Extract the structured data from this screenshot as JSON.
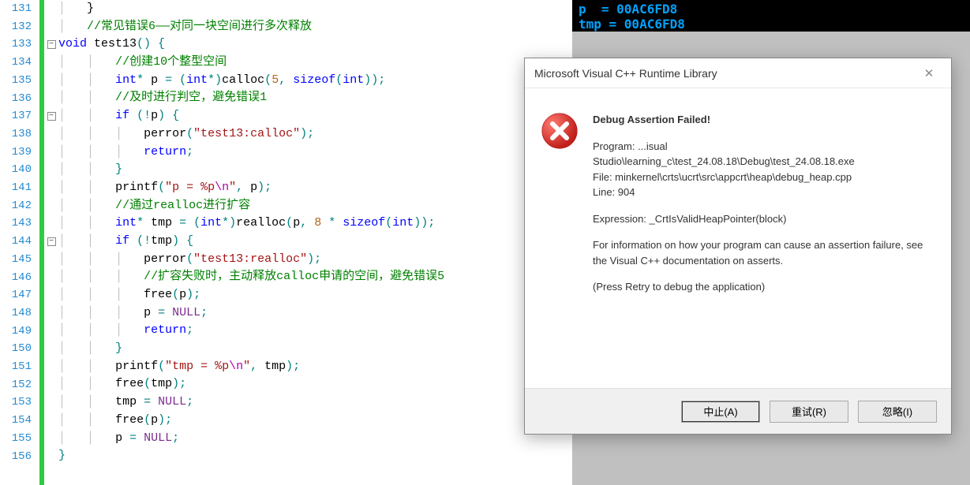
{
  "editor": {
    "first_line": 131,
    "last_line": 156,
    "fold_lines": [
      133,
      137,
      144
    ],
    "lines": [
      {
        "n": 131,
        "indent": 1,
        "segs": [
          {
            "t": "}",
            "c": "paren"
          }
        ]
      },
      {
        "n": 132,
        "indent": 1,
        "segs": [
          {
            "t": "//常见错误6——对同一块空间进行多次释放",
            "c": "comment"
          }
        ]
      },
      {
        "n": 133,
        "indent": 0,
        "fold": true,
        "segs": [
          {
            "t": "void",
            "c": "keyword"
          },
          {
            "t": " test13",
            "c": "ident"
          },
          {
            "t": "() {",
            "c": "op"
          }
        ]
      },
      {
        "n": 134,
        "indent": 2,
        "segs": [
          {
            "t": "//创建10个整型空间",
            "c": "comment"
          }
        ]
      },
      {
        "n": 135,
        "indent": 2,
        "segs": [
          {
            "t": "int",
            "c": "type"
          },
          {
            "t": "* ",
            "c": "op"
          },
          {
            "t": "p ",
            "c": "ident"
          },
          {
            "t": "= (",
            "c": "op"
          },
          {
            "t": "int",
            "c": "type"
          },
          {
            "t": "*)",
            "c": "op"
          },
          {
            "t": "calloc",
            "c": "func"
          },
          {
            "t": "(",
            "c": "op"
          },
          {
            "t": "5",
            "c": "number"
          },
          {
            "t": ", ",
            "c": "op"
          },
          {
            "t": "sizeof",
            "c": "keyword"
          },
          {
            "t": "(",
            "c": "op"
          },
          {
            "t": "int",
            "c": "type"
          },
          {
            "t": "));",
            "c": "op"
          }
        ]
      },
      {
        "n": 136,
        "indent": 2,
        "segs": [
          {
            "t": "//及时进行判空，避免错误1",
            "c": "comment"
          }
        ]
      },
      {
        "n": 137,
        "indent": 2,
        "fold": true,
        "segs": [
          {
            "t": "if",
            "c": "keyword"
          },
          {
            "t": " (!",
            "c": "op"
          },
          {
            "t": "p",
            "c": "ident"
          },
          {
            "t": ") {",
            "c": "op"
          }
        ]
      },
      {
        "n": 138,
        "indent": 3,
        "segs": [
          {
            "t": "perror",
            "c": "func"
          },
          {
            "t": "(",
            "c": "op"
          },
          {
            "t": "\"test13:calloc\"",
            "c": "string"
          },
          {
            "t": ");",
            "c": "op"
          }
        ]
      },
      {
        "n": 139,
        "indent": 3,
        "segs": [
          {
            "t": "return",
            "c": "keyword"
          },
          {
            "t": ";",
            "c": "op"
          }
        ]
      },
      {
        "n": 140,
        "indent": 2,
        "segs": [
          {
            "t": "}",
            "c": "op"
          }
        ]
      },
      {
        "n": 141,
        "indent": 2,
        "segs": [
          {
            "t": "printf",
            "c": "func"
          },
          {
            "t": "(",
            "c": "op"
          },
          {
            "t": "\"p = %p",
            "c": "string"
          },
          {
            "t": "\\n",
            "c": "escape"
          },
          {
            "t": "\"",
            "c": "string"
          },
          {
            "t": ", ",
            "c": "op"
          },
          {
            "t": "p",
            "c": "ident"
          },
          {
            "t": ");",
            "c": "op"
          }
        ]
      },
      {
        "n": 142,
        "indent": 2,
        "segs": [
          {
            "t": "//通过realloc进行扩容",
            "c": "comment"
          }
        ]
      },
      {
        "n": 143,
        "indent": 2,
        "segs": [
          {
            "t": "int",
            "c": "type"
          },
          {
            "t": "* ",
            "c": "op"
          },
          {
            "t": "tmp ",
            "c": "ident"
          },
          {
            "t": "= (",
            "c": "op"
          },
          {
            "t": "int",
            "c": "type"
          },
          {
            "t": "*)",
            "c": "op"
          },
          {
            "t": "realloc",
            "c": "func"
          },
          {
            "t": "(",
            "c": "op"
          },
          {
            "t": "p",
            "c": "ident"
          },
          {
            "t": ", ",
            "c": "op"
          },
          {
            "t": "8",
            "c": "number"
          },
          {
            "t": " * ",
            "c": "op"
          },
          {
            "t": "sizeof",
            "c": "keyword"
          },
          {
            "t": "(",
            "c": "op"
          },
          {
            "t": "int",
            "c": "type"
          },
          {
            "t": "));",
            "c": "op"
          }
        ]
      },
      {
        "n": 144,
        "indent": 2,
        "fold": true,
        "segs": [
          {
            "t": "if",
            "c": "keyword"
          },
          {
            "t": " (!",
            "c": "op"
          },
          {
            "t": "tmp",
            "c": "ident"
          },
          {
            "t": ") {",
            "c": "op"
          }
        ]
      },
      {
        "n": 145,
        "indent": 3,
        "segs": [
          {
            "t": "perror",
            "c": "func"
          },
          {
            "t": "(",
            "c": "op"
          },
          {
            "t": "\"test13:realloc\"",
            "c": "string"
          },
          {
            "t": ");",
            "c": "op"
          }
        ]
      },
      {
        "n": 146,
        "indent": 3,
        "segs": [
          {
            "t": "//扩容失败时，主动释放calloc申请的空间，避免错误5",
            "c": "comment"
          }
        ]
      },
      {
        "n": 147,
        "indent": 3,
        "segs": [
          {
            "t": "free",
            "c": "func"
          },
          {
            "t": "(",
            "c": "op"
          },
          {
            "t": "p",
            "c": "ident"
          },
          {
            "t": ");",
            "c": "op"
          }
        ]
      },
      {
        "n": 148,
        "indent": 3,
        "segs": [
          {
            "t": "p ",
            "c": "ident"
          },
          {
            "t": "= ",
            "c": "op"
          },
          {
            "t": "NULL",
            "c": "purple"
          },
          {
            "t": ";",
            "c": "op"
          }
        ]
      },
      {
        "n": 149,
        "indent": 3,
        "segs": [
          {
            "t": "return",
            "c": "keyword"
          },
          {
            "t": ";",
            "c": "op"
          }
        ]
      },
      {
        "n": 150,
        "indent": 2,
        "segs": [
          {
            "t": "}",
            "c": "op"
          }
        ]
      },
      {
        "n": 151,
        "indent": 2,
        "segs": [
          {
            "t": "printf",
            "c": "func"
          },
          {
            "t": "(",
            "c": "op"
          },
          {
            "t": "\"tmp = %p",
            "c": "string"
          },
          {
            "t": "\\n",
            "c": "escape"
          },
          {
            "t": "\"",
            "c": "string"
          },
          {
            "t": ", ",
            "c": "op"
          },
          {
            "t": "tmp",
            "c": "ident"
          },
          {
            "t": ");",
            "c": "op"
          }
        ]
      },
      {
        "n": 152,
        "indent": 2,
        "segs": [
          {
            "t": "free",
            "c": "func"
          },
          {
            "t": "(",
            "c": "op"
          },
          {
            "t": "tmp",
            "c": "ident"
          },
          {
            "t": ");",
            "c": "op"
          }
        ]
      },
      {
        "n": 153,
        "indent": 2,
        "segs": [
          {
            "t": "tmp ",
            "c": "ident"
          },
          {
            "t": "= ",
            "c": "op"
          },
          {
            "t": "NULL",
            "c": "purple"
          },
          {
            "t": ";",
            "c": "op"
          }
        ]
      },
      {
        "n": 154,
        "indent": 2,
        "segs": [
          {
            "t": "free",
            "c": "func"
          },
          {
            "t": "(",
            "c": "op"
          },
          {
            "t": "p",
            "c": "ident"
          },
          {
            "t": ");",
            "c": "op"
          }
        ]
      },
      {
        "n": 155,
        "indent": 2,
        "segs": [
          {
            "t": "p ",
            "c": "ident"
          },
          {
            "t": "= ",
            "c": "op"
          },
          {
            "t": "NULL",
            "c": "purple"
          },
          {
            "t": ";",
            "c": "op"
          }
        ]
      },
      {
        "n": 156,
        "indent": 0,
        "segs": [
          {
            "t": "}",
            "c": "op"
          }
        ]
      }
    ]
  },
  "console": {
    "line1": "p  = 00AC6FD8",
    "line2": "tmp = 00AC6FD8"
  },
  "dialog": {
    "title": "Microsoft Visual C++ Runtime Library",
    "heading": "Debug Assertion Failed!",
    "program_label": "Program: ...isual",
    "program_path": "Studio\\learning_c\\test_24.08.18\\Debug\\test_24.08.18.exe",
    "file": "File: minkernel\\crts\\ucrt\\src\\appcrt\\heap\\debug_heap.cpp",
    "line": "Line: 904",
    "expression": "Expression: _CrtIsValidHeapPointer(block)",
    "info": "For information on how your program can cause an assertion failure, see the Visual C++ documentation on asserts.",
    "retry_hint": "(Press Retry to debug the application)",
    "buttons": {
      "abort": "中止(A)",
      "retry": "重试(R)",
      "ignore": "忽略(I)"
    }
  }
}
